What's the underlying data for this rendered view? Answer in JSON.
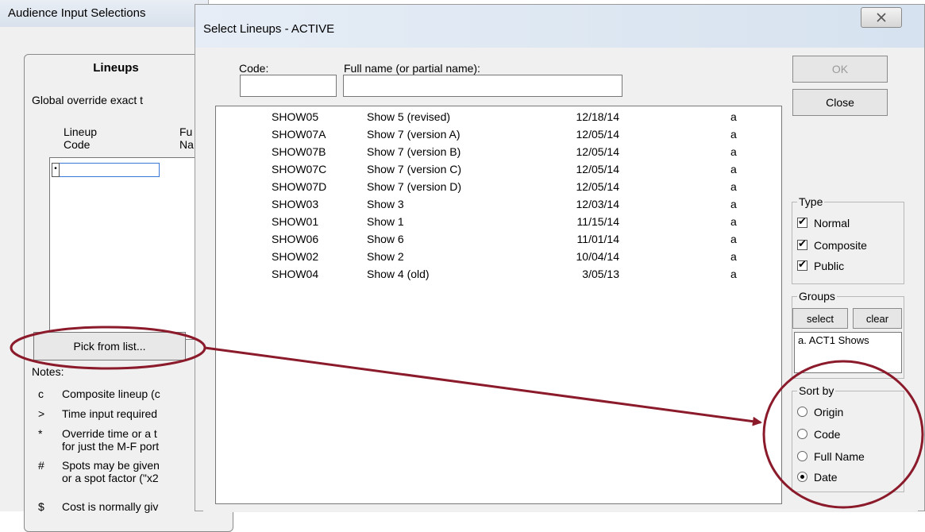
{
  "background_window": {
    "title": "Audience Input Selections",
    "panel_title": "Lineups",
    "global_text": "Global override exact t",
    "col1_line1": "Lineup",
    "col1_line2": "Code",
    "col2_line1": "Fu",
    "col2_line2": "Na",
    "pick_button": "Pick from list...",
    "notes_label": "Notes:",
    "notes": [
      {
        "symbol": "c",
        "line1": "Composite lineup (c",
        "line2": ""
      },
      {
        "symbol": ">",
        "line1": "Time input required",
        "line2": ""
      },
      {
        "symbol": "*",
        "line1": "Override time or a t",
        "line2": "for just the M-F port"
      },
      {
        "symbol": "#",
        "line1": "Spots may be given",
        "line2": "or a spot factor (\"x2"
      },
      {
        "symbol": "$",
        "line1": "Cost is normally giv",
        "line2": ""
      }
    ]
  },
  "dialog": {
    "title": "Select Lineups - ACTIVE",
    "close_glyph": "X",
    "code_label": "Code:",
    "fullname_label": "Full name (or partial name):",
    "code_value": "",
    "fullname_value": "",
    "ok_label": "OK",
    "close_label": "Close",
    "rows": [
      {
        "code": "SHOW05",
        "name": "Show 5 (revised)",
        "date": "12/18/14",
        "flag": "a"
      },
      {
        "code": "SHOW07A",
        "name": "Show 7 (version A)",
        "date": "12/05/14",
        "flag": "a"
      },
      {
        "code": "SHOW07B",
        "name": "Show 7 (version B)",
        "date": "12/05/14",
        "flag": "a"
      },
      {
        "code": "SHOW07C",
        "name": "Show 7 (version C)",
        "date": "12/05/14",
        "flag": "a"
      },
      {
        "code": "SHOW07D",
        "name": "Show 7 (version D)",
        "date": "12/05/14",
        "flag": "a"
      },
      {
        "code": "SHOW03",
        "name": "Show 3",
        "date": "12/03/14",
        "flag": "a"
      },
      {
        "code": "SHOW01",
        "name": "Show 1",
        "date": "11/15/14",
        "flag": "a"
      },
      {
        "code": "SHOW06",
        "name": "Show 6",
        "date": "11/01/14",
        "flag": "a"
      },
      {
        "code": "SHOW02",
        "name": "Show 2",
        "date": "10/04/14",
        "flag": "a"
      },
      {
        "code": "SHOW04",
        "name": "Show 4 (old)",
        "date": "3/05/13",
        "flag": "a"
      }
    ],
    "type_legend": "Type",
    "type_options": [
      {
        "label": "Normal",
        "checked": true
      },
      {
        "label": "Composite",
        "checked": true
      },
      {
        "label": "Public",
        "checked": true
      }
    ],
    "groups_legend": "Groups",
    "groups_select": "select",
    "groups_clear": "clear",
    "groups_items": [
      "a. ACT1 Shows"
    ],
    "sortby_legend": "Sort by",
    "sort_options": [
      {
        "label": "Origin",
        "selected": false
      },
      {
        "label": "Code",
        "selected": false
      },
      {
        "label": "Full Name",
        "selected": false
      },
      {
        "label": "Date",
        "selected": true
      }
    ]
  },
  "colors": {
    "annotation": "#8b1a2b",
    "title_gradient": "#d6e2ef",
    "focus_border": "#3a78d8"
  }
}
